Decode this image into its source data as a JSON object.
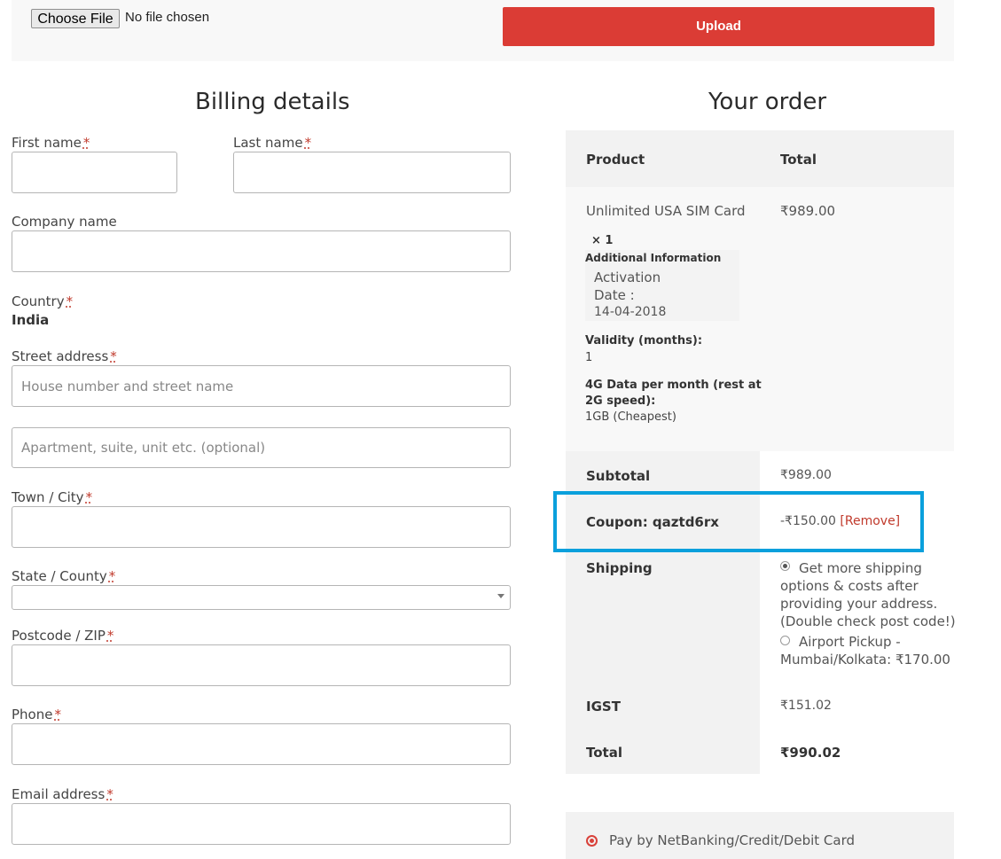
{
  "upload": {
    "choose_file": "Choose File",
    "file_status": "No file chosen",
    "upload_button": "Upload"
  },
  "billing": {
    "title": "Billing details",
    "first_name_label": "First name",
    "last_name_label": "Last name",
    "company_label": "Company name",
    "country_label": "Country",
    "country_value": "India",
    "street_label": "Street address",
    "street_placeholder": "House number and street name",
    "apartment_placeholder": "Apartment, suite, unit etc. (optional)",
    "city_label": "Town / City",
    "state_label": "State / County",
    "postcode_label": "Postcode / ZIP",
    "phone_label": "Phone",
    "email_label": "Email address",
    "required_mark": "*"
  },
  "order": {
    "title": "Your order",
    "col_product": "Product",
    "col_total": "Total",
    "item_name": "Unlimited USA SIM Card",
    "item_qty": "× 1",
    "item_price": "₹989.00",
    "additional_info_label": "Additional Information",
    "activation_label_1": "Activation",
    "activation_label_2": "Date :",
    "activation_value": "14-04-2018",
    "validity_label": "Validity (months):",
    "validity_value": "1",
    "data_label_1": "4G Data per month (rest at",
    "data_label_2": "2G speed):",
    "data_value": "1GB (Cheapest)",
    "subtotal_label": "Subtotal",
    "subtotal_value": "₹989.00",
    "coupon_label": "Coupon: qaztd6rx",
    "coupon_value": "-₹150.00",
    "coupon_remove": "[Remove]",
    "shipping_label": "Shipping",
    "shipping_opt1_l1": "Get more shipping",
    "shipping_opt1_l2": "options & costs after",
    "shipping_opt1_l3": "providing your address.",
    "shipping_opt1_l4": "(Double check post code!)",
    "shipping_opt2_l1": "Airport Pickup -",
    "shipping_opt2_l2": "Mumbai/Kolkata: ₹170.00",
    "igst_label": "IGST",
    "igst_value": "₹151.02",
    "total_label": "Total",
    "total_value": "₹990.02"
  },
  "payment": {
    "option_label": "Pay by NetBanking/Credit/Debit Card"
  }
}
